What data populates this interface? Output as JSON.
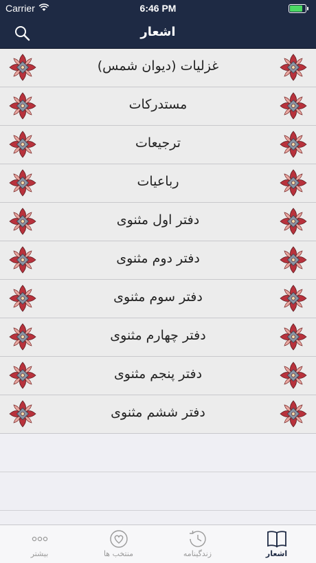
{
  "status_bar": {
    "carrier": "Carrier",
    "time": "6:46 PM",
    "battery_level": 0.9,
    "battery_color": "#4cd964"
  },
  "nav": {
    "title": "اشعار",
    "search_icon": "search-icon",
    "background_color": "#1e2a44"
  },
  "poems": [
    {
      "label": "غزلیات (دیوان شمس)"
    },
    {
      "label": "مستدرکات"
    },
    {
      "label": "ترجیعات"
    },
    {
      "label": "رباعیات"
    },
    {
      "label": "دفتر اول مثنوی"
    },
    {
      "label": "دفتر دوم مثنوی"
    },
    {
      "label": "دفتر سوم مثنوی"
    },
    {
      "label": "دفتر چهارم مثنوی"
    },
    {
      "label": "دفتر پنجم مثنوی"
    },
    {
      "label": "دفتر ششم مثنوی"
    }
  ],
  "tabs": [
    {
      "label": "بیشتر",
      "icon": "more-dots-icon",
      "active": false
    },
    {
      "label": "منتخب ها",
      "icon": "heart-icon",
      "active": false
    },
    {
      "label": "زندگینامه",
      "icon": "history-clock-icon",
      "active": false
    },
    {
      "label": "اشعار",
      "icon": "open-book-icon",
      "active": true
    }
  ]
}
